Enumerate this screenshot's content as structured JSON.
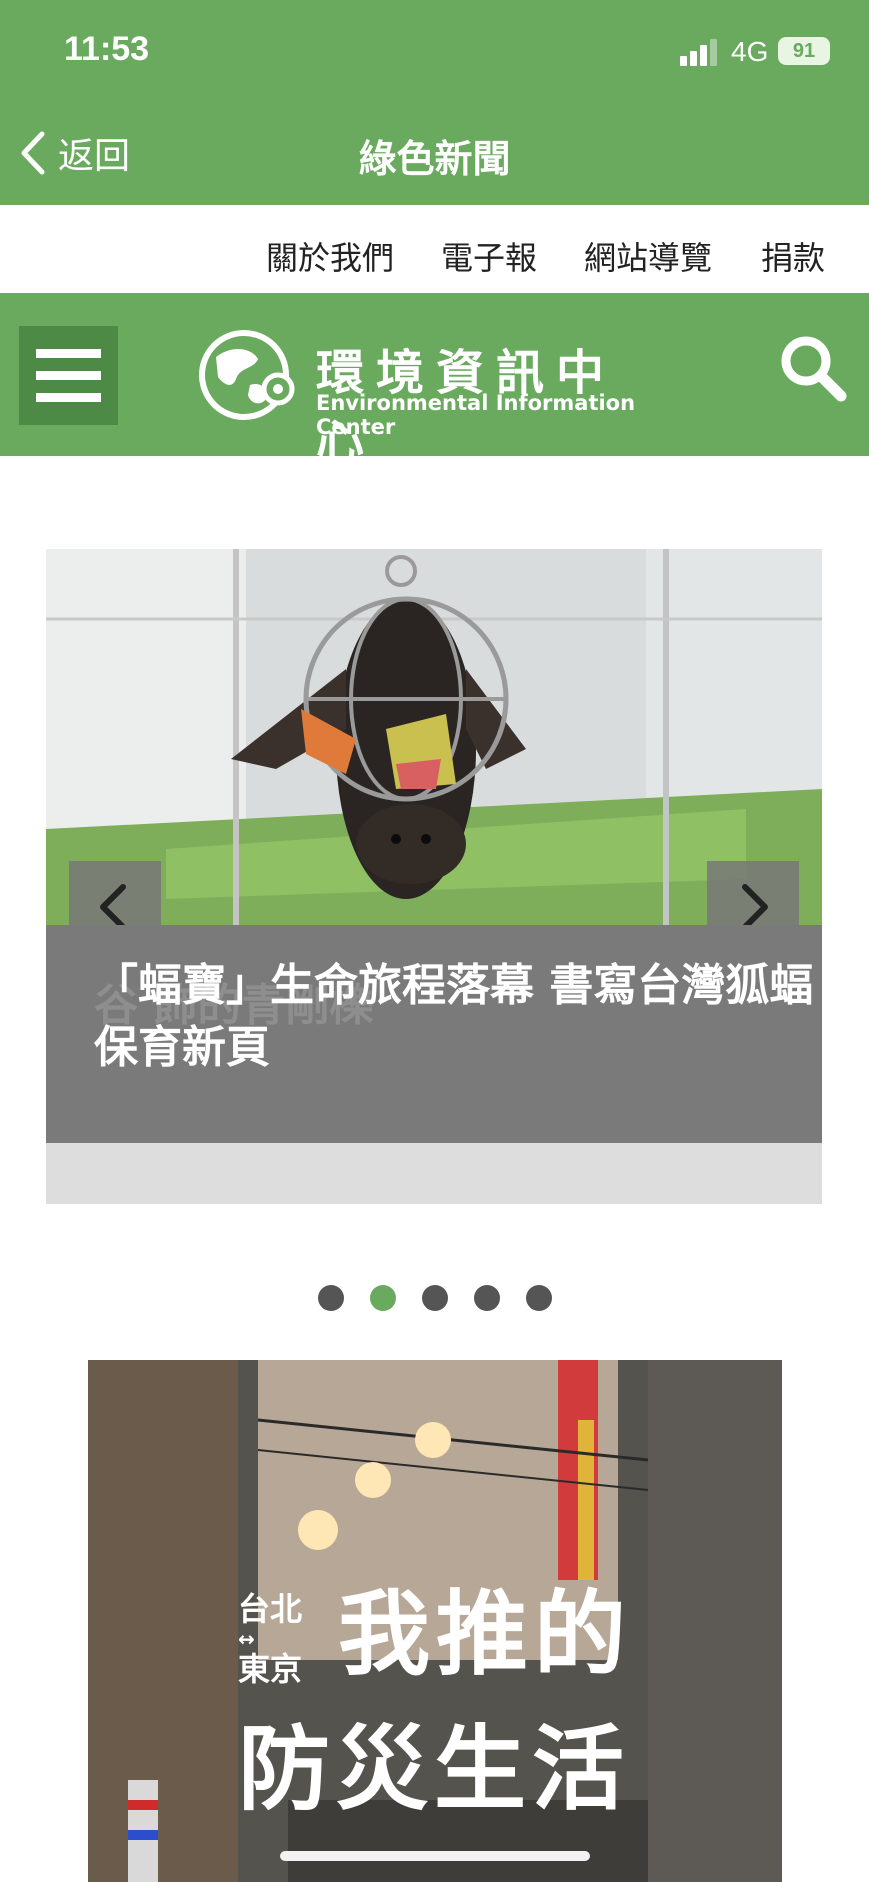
{
  "status_bar": {
    "time": "11:53",
    "network": "4G",
    "battery": "91"
  },
  "nav": {
    "back_label": "返回",
    "title": "綠色新聞"
  },
  "top_links": [
    "關於我們",
    "電子報",
    "網站導覽",
    "捐款"
  ],
  "site": {
    "name_zh": "環境資訊中心",
    "name_en": "Environmental Information Center"
  },
  "carousel": {
    "caption": "「蝠寶」生命旅程落幕 書寫台灣狐蝠保育新頁",
    "ghost_caption": "谷 飾的青剛櫟",
    "slides_count": 5,
    "active_index": 2
  },
  "poster": {
    "line1": "台北",
    "line2": "東京",
    "headline1": "我推的",
    "headline2": "防災生活"
  },
  "colors": {
    "brand_green": "#6aaa5e",
    "dark_green": "#4d8a45",
    "caption_gray": "#7a7a7a"
  }
}
